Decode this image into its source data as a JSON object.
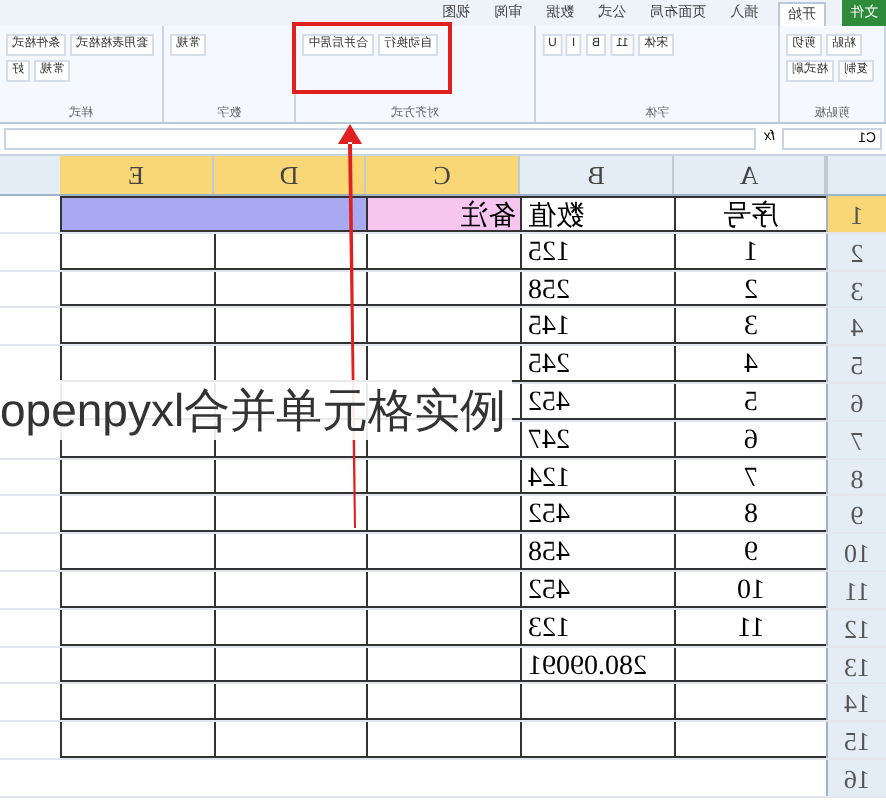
{
  "ribbon": {
    "tabs": [
      {
        "label": "视图",
        "kind": "tab",
        "selected": false
      },
      {
        "label": "审阅",
        "kind": "tab",
        "selected": false
      },
      {
        "label": "数据",
        "kind": "tab",
        "selected": false
      },
      {
        "label": "公式",
        "kind": "tab",
        "selected": false
      },
      {
        "label": "页面布局",
        "kind": "tab",
        "selected": false
      },
      {
        "label": "插入",
        "kind": "tab",
        "selected": false
      },
      {
        "label": "开始",
        "kind": "tab",
        "selected": true
      },
      {
        "label": "文件",
        "kind": "file",
        "selected": false
      }
    ],
    "groups": [
      {
        "title": "样式",
        "buttons": [
          "条件格式",
          "套用表格格式",
          "好",
          "常规"
        ]
      },
      {
        "title": "数字",
        "buttons": [
          "常规"
        ]
      },
      {
        "title": "对齐方式",
        "buttons": [
          "合并后居中",
          "自动换行"
        ]
      },
      {
        "title": "字体",
        "buttons": [
          "U",
          "I",
          "B",
          "11",
          "宋体"
        ]
      },
      {
        "title": "剪贴板",
        "buttons": [
          "剪切",
          "粘贴",
          "格式刷",
          "复制"
        ]
      }
    ]
  },
  "formula_bar": {
    "fx": "fx",
    "name_box": "C1"
  },
  "sheet": {
    "columns": [
      {
        "label": "E",
        "selected": true
      },
      {
        "label": "D",
        "selected": true
      },
      {
        "label": "C",
        "selected": true
      },
      {
        "label": "B",
        "selected": false
      },
      {
        "label": "A",
        "selected": false
      }
    ],
    "rows": [
      {
        "header": "1",
        "selected": true,
        "cells": [
          "备注",
          "数值",
          "序号"
        ]
      },
      {
        "header": "2",
        "selected": false,
        "cells": [
          "",
          "125",
          "1"
        ]
      },
      {
        "header": "3",
        "selected": false,
        "cells": [
          "",
          "258",
          "2"
        ]
      },
      {
        "header": "4",
        "selected": false,
        "cells": [
          "",
          "145",
          "3"
        ]
      },
      {
        "header": "5",
        "selected": false,
        "cells": [
          "",
          "245",
          "4"
        ]
      },
      {
        "header": "6",
        "selected": false,
        "cells": [
          "",
          "452",
          "5"
        ]
      },
      {
        "header": "7",
        "selected": false,
        "cells": [
          "",
          "247",
          "6"
        ]
      },
      {
        "header": "8",
        "selected": false,
        "cells": [
          "",
          "124",
          "7"
        ]
      },
      {
        "header": "9",
        "selected": false,
        "cells": [
          "",
          "452",
          "8"
        ]
      },
      {
        "header": "10",
        "selected": false,
        "cells": [
          "",
          "458",
          "9"
        ]
      },
      {
        "header": "11",
        "selected": false,
        "cells": [
          "",
          "452",
          "10"
        ]
      },
      {
        "header": "12",
        "selected": false,
        "cells": [
          "",
          "123",
          "11"
        ]
      },
      {
        "header": "13",
        "selected": false,
        "cells": [
          "",
          "280.09091",
          ""
        ]
      },
      {
        "header": "14",
        "selected": false,
        "cells": [
          "",
          "",
          ""
        ]
      },
      {
        "header": "15",
        "selected": false,
        "cells": [
          "",
          "",
          ""
        ]
      },
      {
        "header": "16",
        "selected": false
      }
    ]
  },
  "caption": "openpyxl合并单元格实例"
}
